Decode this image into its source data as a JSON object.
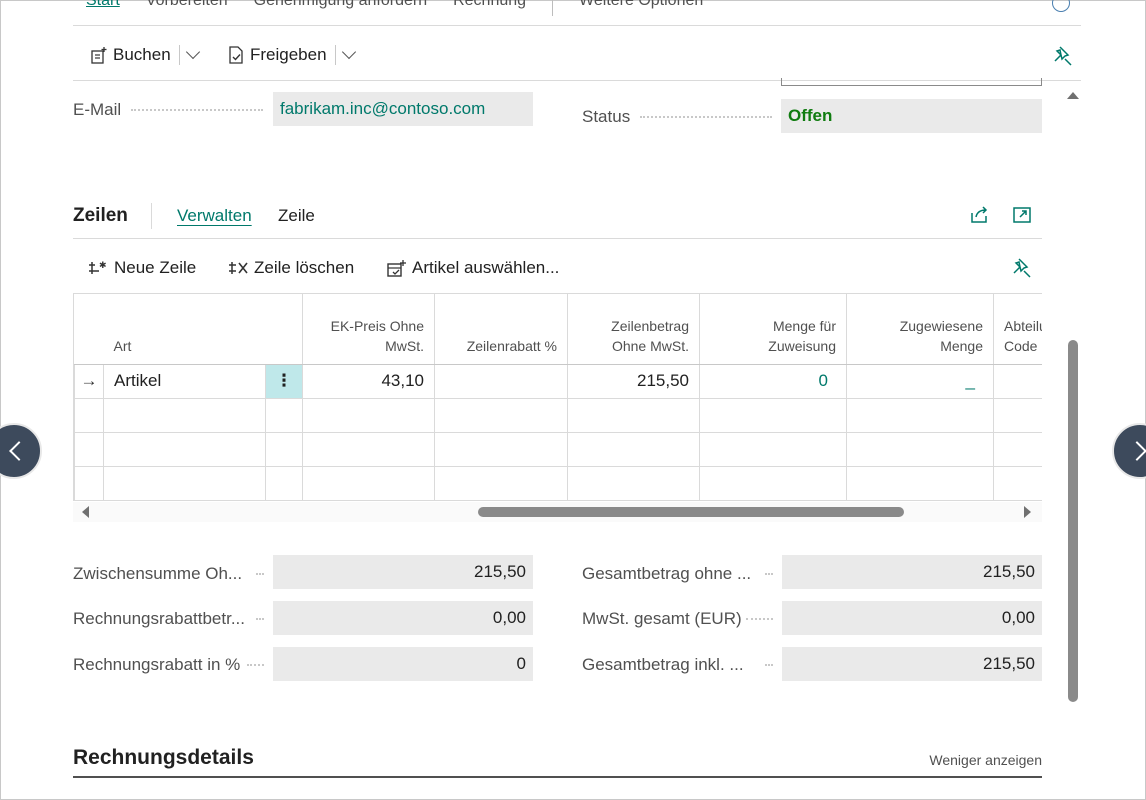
{
  "top_tabs": [
    "Start",
    "Vorbereiten",
    "Genehmigung anfordern",
    "Rechnung",
    "Weitere Optionen"
  ],
  "actions": {
    "post": "Buchen",
    "release": "Freigeben"
  },
  "header_fields": {
    "email_label": "E-Mail",
    "email_value": "fabrikam.inc@contoso.com",
    "status_label": "Status",
    "status_value": "Offen"
  },
  "lines": {
    "title": "Zeilen",
    "tabs": [
      "Verwalten",
      "Zeile"
    ],
    "actions": {
      "new_line": "Neue Zeile",
      "delete_line": "Zeile löschen",
      "select_items": "Artikel auswählen..."
    },
    "columns": {
      "art": "Art",
      "ek_preis_1": "EK-Preis Ohne",
      "ek_preis_2": "MwSt.",
      "zeilenrabatt": "Zeilenrabatt %",
      "zeilenbetrag_1": "Zeilenbetrag",
      "zeilenbetrag_2": "Ohne MwSt.",
      "menge_zuw_1": "Menge für",
      "menge_zuw_2": "Zuweisung",
      "zugewiesen_1": "Zugewiesene",
      "zugewiesen_2": "Menge",
      "abteilung_1": "Abteilu",
      "abteilung_2": "Code"
    },
    "rows": [
      {
        "art": "Artikel",
        "ek_preis": "43,10",
        "zeilenrabatt": "",
        "zeilenbetrag": "215,50",
        "menge_zuweisung": "0",
        "zugewiesen": "_",
        "abteilung": ""
      }
    ],
    "row_menu_glyph": "⋮",
    "row_arrow_glyph": "→"
  },
  "totals": {
    "subtotal_label": "Zwischensumme Oh...",
    "subtotal_value": "215,50",
    "discount_amount_label": "Rechnungsrabattbetr...",
    "discount_amount_value": "0,00",
    "discount_pct_label": "Rechnungsrabatt in %",
    "discount_pct_value": "0",
    "total_excl_label": "Gesamtbetrag ohne ...",
    "total_excl_value": "215,50",
    "vat_label": "MwSt. gesamt (EUR)",
    "vat_value": "0,00",
    "total_incl_label": "Gesamtbetrag inkl. ...",
    "total_incl_value": "215,50"
  },
  "details": {
    "title": "Rechnungsdetails",
    "show_less": "Weniger anzeigen"
  },
  "colors": {
    "accent": "#00796b",
    "status_ok": "#107c10",
    "field_bg": "#eaeaea",
    "selected_cell": "#bfe8ea"
  }
}
